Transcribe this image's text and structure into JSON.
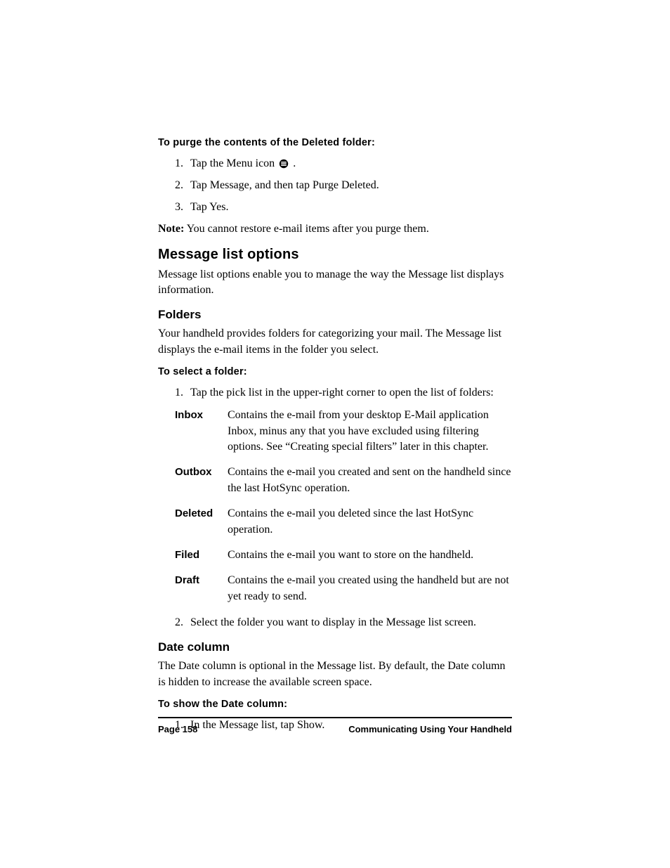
{
  "purge": {
    "heading": "To purge the contents of the Deleted folder:",
    "steps": [
      {
        "num": "1.",
        "text_before_icon": "Tap the Menu icon ",
        "text_after_icon": " ."
      },
      {
        "num": "2.",
        "text": "Tap Message, and then tap Purge Deleted."
      },
      {
        "num": "3.",
        "text": "Tap Yes."
      }
    ],
    "note_label": "Note:",
    "note_text": " You cannot restore e-mail items after you purge them."
  },
  "message_list_options": {
    "heading": "Message list options",
    "intro": "Message list options enable you to manage the way the Message list displays information."
  },
  "folders": {
    "heading": "Folders",
    "intro": "Your handheld provides folders for categorizing your mail. The Message list displays the e-mail items in the folder you select.",
    "select_heading": "To select a folder:",
    "step1": {
      "num": "1.",
      "text": "Tap the pick list in the upper-right corner to open the list of folders:"
    },
    "rows": [
      {
        "name": "Inbox",
        "desc": "Contains the e-mail from your desktop E-Mail application Inbox, minus any that you have excluded using filtering options. See “Creating special filters” later in this chapter."
      },
      {
        "name": "Outbox",
        "desc": "Contains the e-mail you created and sent on the handheld since the last HotSync operation."
      },
      {
        "name": "Deleted",
        "desc": "Contains the e-mail you deleted since the last HotSync operation."
      },
      {
        "name": "Filed",
        "desc": "Contains the e-mail you want to store on the handheld."
      },
      {
        "name": "Draft",
        "desc": "Contains the e-mail you created using the handheld but are not yet ready to send."
      }
    ],
    "step2": {
      "num": "2.",
      "text": "Select the folder you want to display in the Message list screen."
    }
  },
  "date_column": {
    "heading": "Date column",
    "intro": "The Date column is optional in the Message list. By default, the Date column is hidden to increase the available screen space.",
    "show_heading": "To show the Date column:",
    "step1": {
      "num": "1.",
      "text": "In the Message list, tap Show."
    }
  },
  "footer": {
    "page": "Page 158",
    "title": "Communicating Using Your Handheld"
  }
}
